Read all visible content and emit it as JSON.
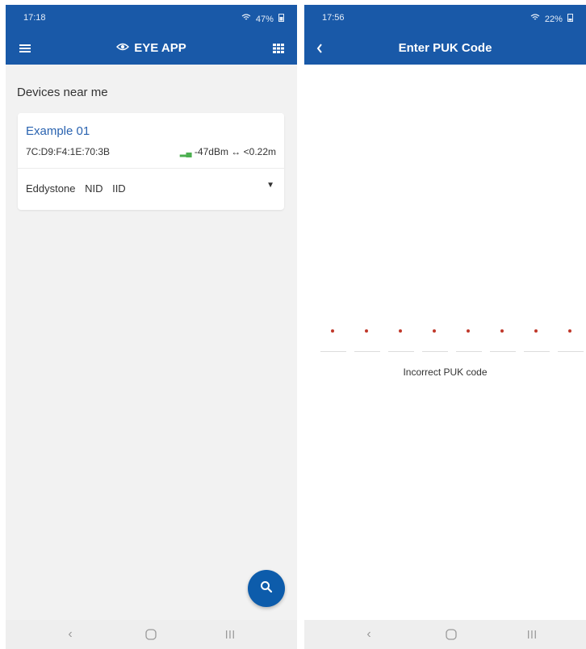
{
  "left_screen": {
    "status_bar": {
      "time": "17:18",
      "icons_text": "47%"
    },
    "app_bar": {
      "title": "EYE APP"
    },
    "section_title": "Devices near me",
    "device": {
      "name": "Example 01",
      "mac": "7C:D9:F4:1E:70:3B",
      "rssi": "-47dBm",
      "distance": "<0.22m",
      "tags": [
        "Eddystone",
        "NID",
        "IID"
      ]
    }
  },
  "right_screen": {
    "status_bar": {
      "time": "17:56",
      "icons_text": "22%"
    },
    "app_bar": {
      "title": "Enter PUK Code"
    },
    "pin_dots": 8,
    "error": "Incorrect PUK code"
  },
  "colors": {
    "primary": "#1959a8",
    "accent_blue_text": "#2a63b0",
    "error_dot": "#c0392b",
    "signal_green": "#4caf50"
  },
  "icons": {
    "menu": "menu-icon",
    "grid": "grid-icon",
    "back": "back-arrow-icon",
    "search": "search-icon",
    "nav_back": "nav-back-icon",
    "nav_home": "nav-home-icon",
    "nav_recents": "nav-recents-icon"
  }
}
